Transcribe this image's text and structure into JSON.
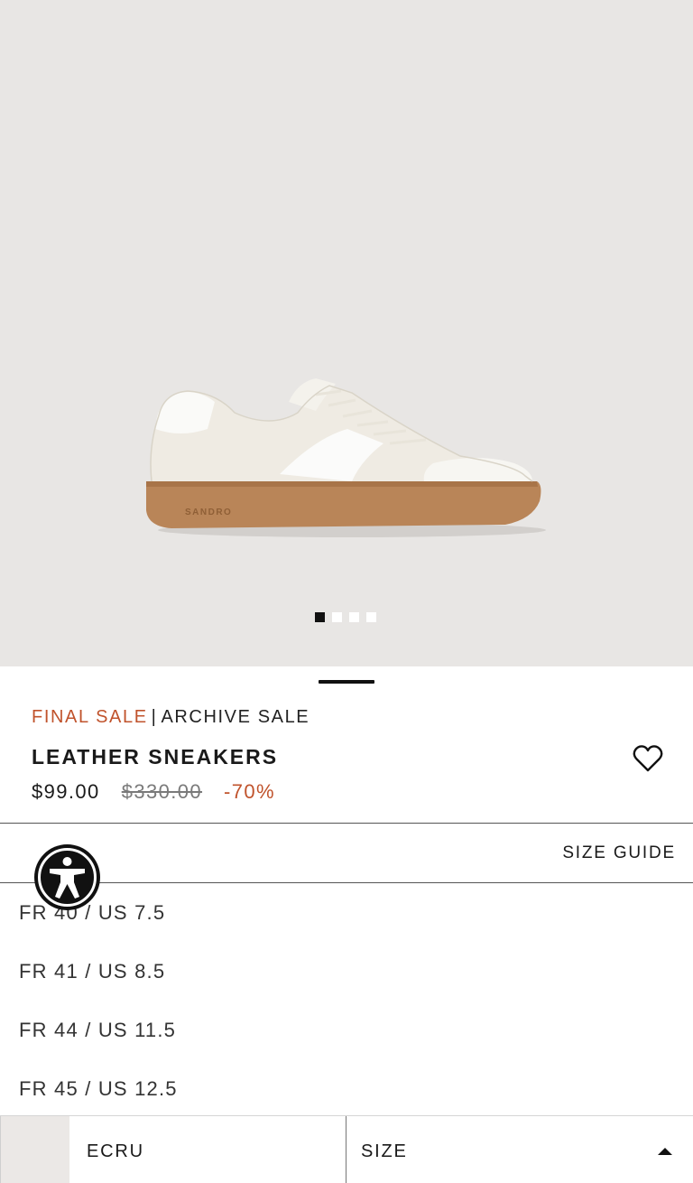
{
  "product": {
    "image_alt": "white leather sneaker with gum sole",
    "sole_brand": "SANDRO",
    "gallery_count": 4,
    "gallery_active_index": 0,
    "sale_tag": "FINAL SALE",
    "sale_separator": "|",
    "sale_collection": "ARCHIVE SALE",
    "title": "LEATHER SNEAKERS",
    "price_current": "$99.00",
    "price_original": "$330.00",
    "discount": "-70%"
  },
  "size_guide_label": "SIZE GUIDE",
  "sizes": [
    "FR 40 / US 7.5",
    "FR 41 / US 8.5",
    "FR 44 / US 11.5",
    "FR 45 / US 12.5"
  ],
  "bottom_bar": {
    "color_name": "ECRU",
    "size_label": "SIZE"
  },
  "colors": {
    "sale_accent": "#c0532c",
    "hero_bg": "#e8e6e4",
    "swatch": "#ebe8e6"
  },
  "icons": {
    "wishlist": "heart-outline-icon",
    "accessibility": "accessibility-icon",
    "dropdown": "caret-up-icon"
  }
}
